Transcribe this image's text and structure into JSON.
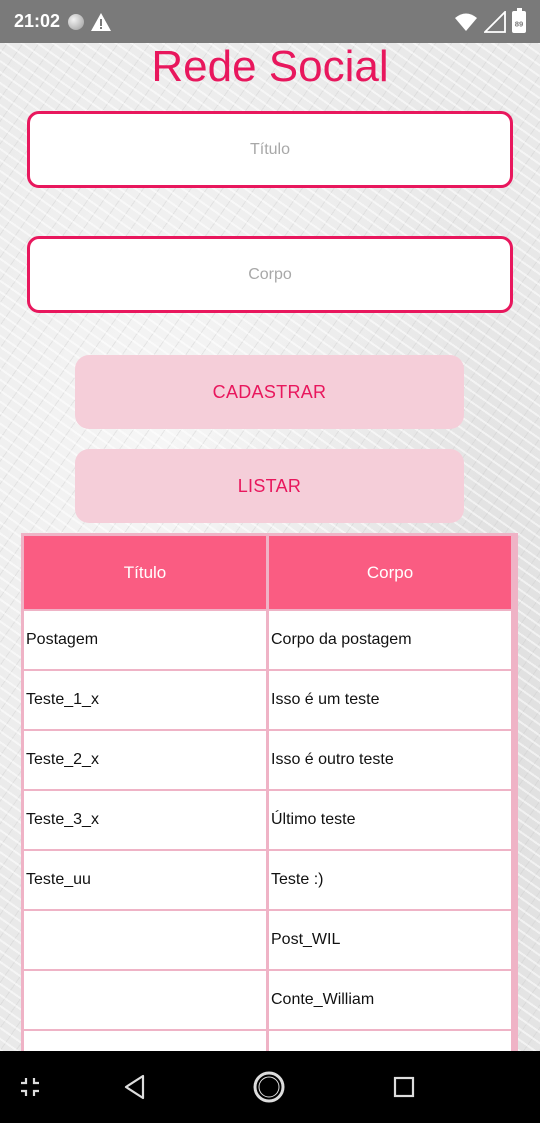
{
  "status_bar": {
    "time": "21:02",
    "battery": "89",
    "icons": [
      "circle-icon",
      "warning-icon",
      "wifi-icon",
      "signal-icon",
      "battery-icon"
    ]
  },
  "app": {
    "title": "Rede Social",
    "title_color": "#e8175d"
  },
  "form": {
    "titulo_placeholder": "Título",
    "corpo_placeholder": "Corpo",
    "titulo_value": "",
    "corpo_value": ""
  },
  "buttons": {
    "cadastrar": "CADASTRAR",
    "listar": "LISTAR"
  },
  "table": {
    "headers": [
      "Título",
      "Corpo"
    ],
    "rows": [
      [
        "Postagem",
        "Corpo da postagem"
      ],
      [
        "Teste_1_x",
        "Isso é um teste"
      ],
      [
        "Teste_2_x",
        "Isso é outro teste"
      ],
      [
        "Teste_3_x",
        "Último teste"
      ],
      [
        "Teste_uu",
        "Teste :)"
      ],
      [
        "",
        "Post_WIL"
      ],
      [
        "",
        "Conte_William"
      ],
      [
        "",
        ""
      ]
    ]
  },
  "nav_bar": {
    "icons": [
      "collapse-icon",
      "back-icon",
      "home-icon",
      "recents-icon"
    ]
  },
  "colors": {
    "accent": "#e8175d",
    "button_bg": "#f5ced9",
    "table_header": "#fa5c82",
    "table_border": "#efb3c6"
  }
}
